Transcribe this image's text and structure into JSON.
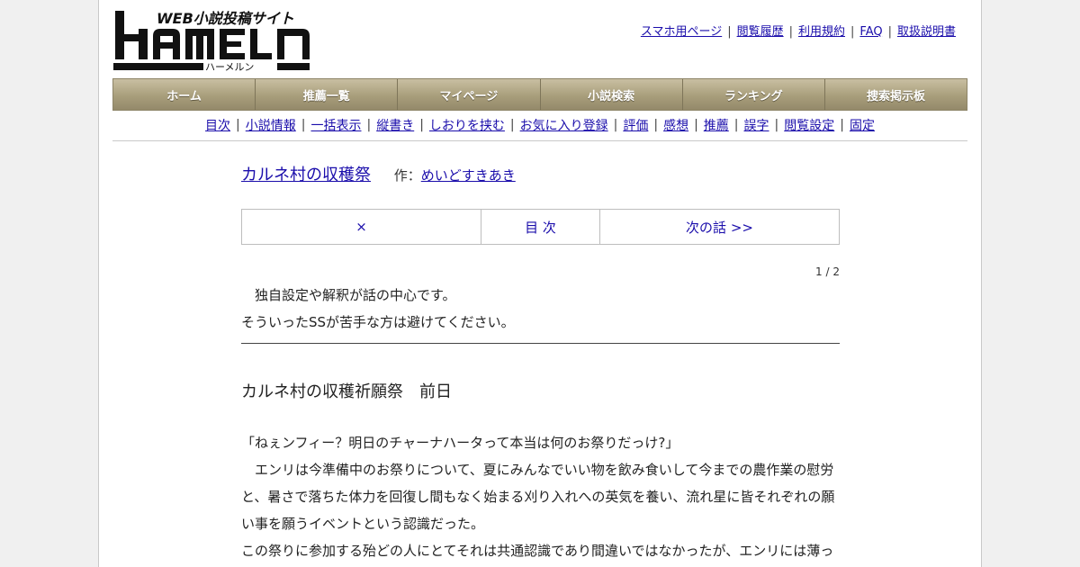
{
  "header": {
    "logo_text": "HAMELN",
    "logo_tagline": "WEB小説投稿サイト",
    "logo_kana": "ハーメルン",
    "top_links": [
      "スマホ用ページ",
      "閲覧履歴",
      "利用規約",
      "FAQ",
      "取扱説明書"
    ]
  },
  "main_nav": [
    "ホーム",
    "推薦一覧",
    "マイページ",
    "小説検索",
    "ランキング",
    "捜索掲示板"
  ],
  "sub_nav": [
    "目次",
    "小説情報",
    "一括表示",
    "縦書き",
    "しおりを挟む",
    "お気に入り登録",
    "評価",
    "感想",
    "推薦",
    "誤字",
    "閲覧設定",
    "固定"
  ],
  "novel": {
    "title": "カルネ村の収穫祭",
    "author_prefix": "作：",
    "author": "めいどすきあき"
  },
  "chapter_nav": {
    "close": "×",
    "toc": "目 次",
    "next": "次の話 >>"
  },
  "page_indicator": "1 / 2",
  "preface": [
    "　独自設定や解釈が話の中心です。",
    "そういったSSが苦手な方は避けてください。"
  ],
  "chapter": {
    "title": "カルネ村の収穫祈願祭　前日",
    "paragraphs": [
      "「ねぇンフィー？明日のチャーナハータって本当は何のお祭りだっけ?」",
      "　エンリは今準備中のお祭りについて、夏にみんなでいい物を飲み食いして今までの農作業の慰労と、暑さで落ちた体力を回復し間もなく始まる刈り入れへの英気を養い、流れ星に皆それぞれの願い事を願うイベントという認識だった。",
      "この祭りに参加する殆どの人にとてそれは共通認識であり間違いではなかったが、エンリには薄っ"
    ]
  }
}
